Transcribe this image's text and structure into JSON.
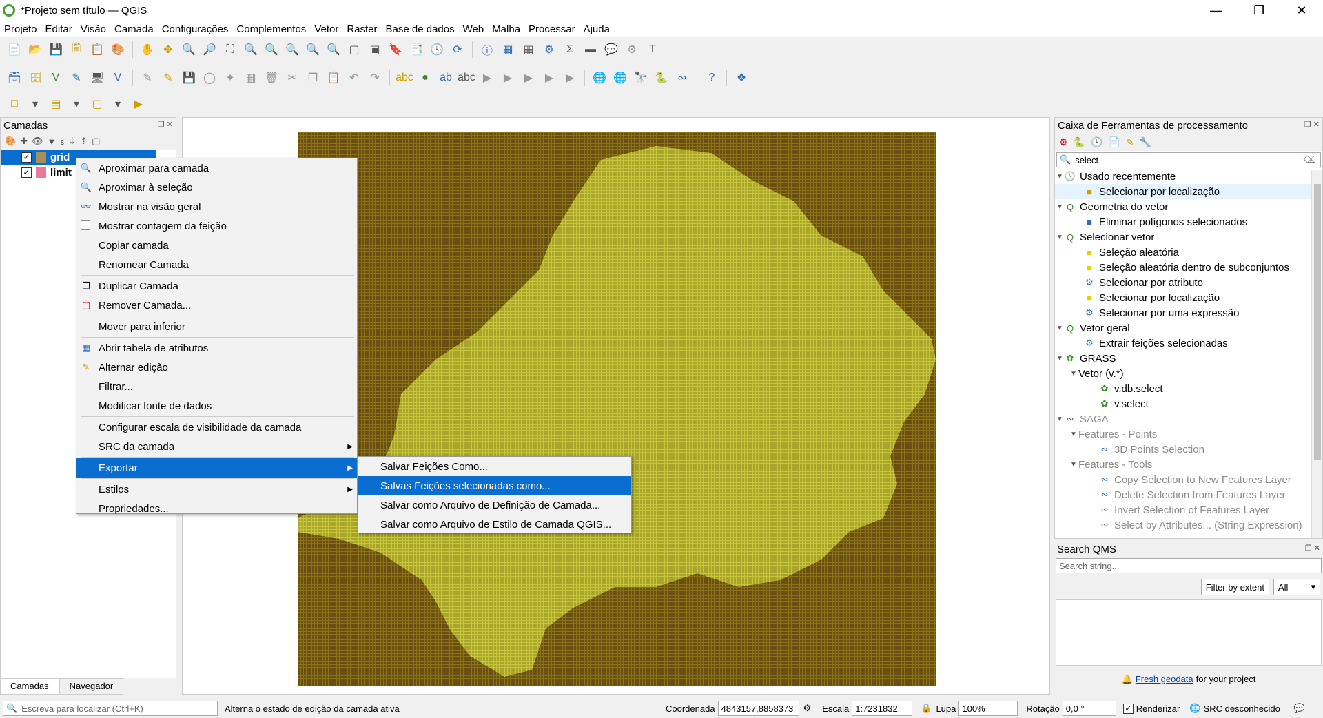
{
  "window": {
    "title": "*Projeto sem título — QGIS"
  },
  "menubar": [
    "Projeto",
    "Editar",
    "Visão",
    "Camada",
    "Configurações",
    "Complementos",
    "Vetor",
    "Raster",
    "Base de dados",
    "Web",
    "Malha",
    "Processar",
    "Ajuda"
  ],
  "layers_panel": {
    "title": "Camadas",
    "layers": [
      {
        "name": "grid",
        "color": "#a98e5a",
        "checked": true,
        "selected": true
      },
      {
        "name": "limit",
        "color": "#e9789a",
        "checked": true,
        "selected": false
      }
    ],
    "tabs": [
      "Camadas",
      "Navegador"
    ]
  },
  "context_menu": {
    "items": [
      {
        "label": "Aproximar para camada",
        "icon": "zoom-icon"
      },
      {
        "label": "Aproximar à seleção",
        "icon": "zoom-selection-icon"
      },
      {
        "label": "Mostrar na visão geral",
        "icon": "glasses-icon"
      },
      {
        "label": "Mostrar contagem da feição",
        "icon": "checkbox-icon"
      },
      {
        "label": "Copiar camada",
        "icon": ""
      },
      {
        "label": "Renomear Camada",
        "icon": ""
      },
      {
        "label": "Duplicar Camada",
        "icon": "duplicate-icon"
      },
      {
        "label": "Remover Camada...",
        "icon": "remove-icon"
      },
      {
        "label": "Mover para inferior",
        "icon": ""
      },
      {
        "label": "Abrir tabela de atributos",
        "icon": "table-icon"
      },
      {
        "label": "Alternar edição",
        "icon": "pencil-icon"
      },
      {
        "label": "Filtrar...",
        "icon": ""
      },
      {
        "label": "Modificar fonte de dados",
        "icon": ""
      },
      {
        "label": "Configurar escala de visibilidade da camada",
        "icon": ""
      },
      {
        "label": "SRC da camada",
        "icon": ""
      },
      {
        "label": "Exportar",
        "icon": ""
      },
      {
        "label": "Estilos",
        "icon": ""
      },
      {
        "label": "Propriedades...",
        "icon": ""
      }
    ],
    "export_submenu": [
      "Salvar Feições Como...",
      "Salvas Feições selecionadas como...",
      "Salvar como Arquivo de Definição de Camada...",
      "Salvar como Arquivo de Estilo de Camada QGIS..."
    ]
  },
  "toolbox": {
    "title": "Caixa de Ferramentas de processamento",
    "search_value": "select",
    "groups": [
      {
        "label": "Usado recentemente",
        "items": [
          "Selecionar por localização"
        ]
      },
      {
        "label": "Geometria do vetor",
        "items": [
          "Eliminar polígonos selecionados"
        ]
      },
      {
        "label": "Selecionar vetor",
        "items": [
          "Seleção aleatória",
          "Seleção aleatória dentro de subconjuntos",
          "Selecionar por atributo",
          "Selecionar por localização",
          "Selecionar por uma expressão"
        ]
      },
      {
        "label": "Vetor geral",
        "items": [
          "Extrair feições selecionadas"
        ]
      },
      {
        "label": "GRASS",
        "sub": "Vetor (v.*)",
        "items": [
          "v.db.select",
          "v.select"
        ]
      },
      {
        "label": "SAGA",
        "sub1": "Features - Points",
        "items1": [
          "3D Points Selection"
        ],
        "sub2": "Features - Tools",
        "items2": [
          "Copy Selection to New Features Layer",
          "Delete Selection from Features Layer",
          "Invert Selection of Features Layer",
          "Select by Attributes... (String Expression)"
        ]
      }
    ]
  },
  "qms": {
    "title": "Search QMS",
    "placeholder": "Search string...",
    "filter_button": "Filter by extent",
    "filter_select": "All",
    "footer_link": "Fresh geodata",
    "footer_text": "for your project"
  },
  "statusbar": {
    "locate_placeholder": "Escreva para localizar (Ctrl+K)",
    "message": "Alterna o estado de edição da camada ativa",
    "coord_label": "Coordenada",
    "coord_value": "4843157,8858373",
    "scale_label": "Escala",
    "scale_value": "1:7231832",
    "lupa_label": "Lupa",
    "lupa_value": "100%",
    "rot_label": "Rotação",
    "rot_value": "0,0 °",
    "render_label": "Renderizar",
    "crs_label": "SRC desconhecido"
  },
  "map": {
    "background": "#6b4e12",
    "polygon_fill": "#a7a62a"
  }
}
